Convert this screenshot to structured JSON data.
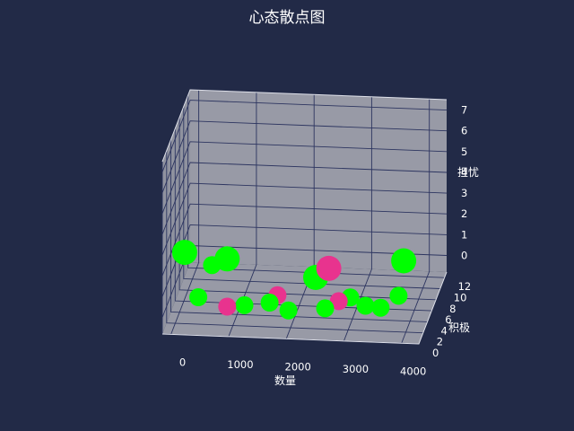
{
  "chart_data": {
    "type": "scatter",
    "title": "心态散点图",
    "xlabel": "数量",
    "ylabel": "积极",
    "zlabel": "担忧",
    "x_ticks": [
      "0",
      "1000",
      "2000",
      "3000",
      "4000"
    ],
    "y_ticks": [
      "0",
      "2",
      "4",
      "6",
      "8",
      "10",
      "12"
    ],
    "z_ticks": [
      "0",
      "1",
      "2",
      "3",
      "4",
      "5",
      "6",
      "7"
    ],
    "xlim": [
      -150,
      4300
    ],
    "ylim": [
      0,
      13
    ],
    "zlim": [
      -0.8,
      7.5
    ],
    "grid": true,
    "colors": {
      "background": "#222a47",
      "pane": "#989aa6",
      "pane_side": "#8f929f",
      "grid": "#2d3560",
      "series_a": "#00ff00",
      "series_b": "#e8338e"
    },
    "series": [
      {
        "color": "#00ff00",
        "points": [
          [
            200,
            1,
            2.9,
            3
          ],
          [
            900,
            2,
            2.4,
            3
          ],
          [
            4000,
            1,
            2.9,
            3
          ],
          [
            2400,
            3,
            1.4,
            3
          ],
          [
            600,
            3,
            1.8,
            2
          ],
          [
            400,
            2,
            0.5,
            2
          ],
          [
            1200,
            2,
            0.2,
            2
          ],
          [
            2000,
            1,
            0.3,
            2
          ],
          [
            3300,
            2,
            0.4,
            2
          ],
          [
            3600,
            1,
            0.6,
            2
          ],
          [
            3800,
            4,
            0.4,
            2
          ],
          [
            1600,
            3,
            0.1,
            2
          ],
          [
            2600,
            2,
            0.2,
            2
          ],
          [
            3000,
            3,
            0.5,
            2
          ]
        ]
      },
      {
        "color": "#e8338e",
        "points": [
          [
            2700,
            1,
            2.4,
            3
          ],
          [
            2800,
            3,
            0.3,
            2
          ],
          [
            900,
            2,
            0.1,
            2
          ],
          [
            1700,
            4,
            0.2,
            2
          ]
        ]
      }
    ]
  }
}
